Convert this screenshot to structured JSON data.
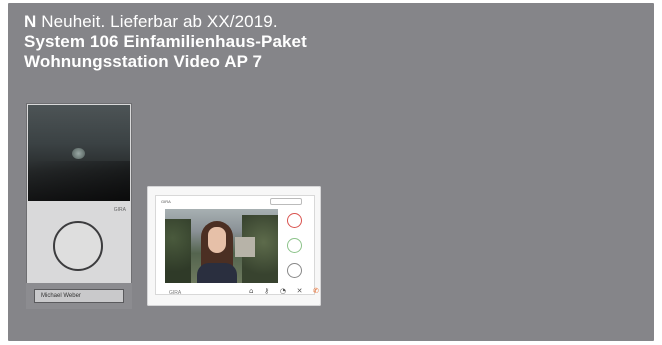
{
  "headline": {
    "line1_prefix": "N",
    "line1_rest": " Neuheit. Lieferbar ab XX/2019.",
    "line2": "System 106 Einfamilienhaus-Paket",
    "line3": "Wohnungsstation Video AP 7"
  },
  "door_station": {
    "brand": "GIRA",
    "name_plate": "Michael Weber"
  },
  "indoor_station": {
    "brand": "GIRA",
    "side_buttons": [
      {
        "icon": "phone-hangup-icon",
        "color": "#d9534f"
      },
      {
        "icon": "phone-accept-icon",
        "color": "#8cc38a"
      },
      {
        "icon": "key-icon",
        "color": "#888888"
      }
    ],
    "footer_icons": [
      {
        "icon": "home-icon"
      },
      {
        "icon": "key-icon"
      },
      {
        "icon": "bell-icon"
      },
      {
        "icon": "mute-icon"
      },
      {
        "icon": "phone-icon",
        "color": "#e96b2b"
      }
    ]
  },
  "colors": {
    "panel_bg": "#858589",
    "text": "#ffffff"
  }
}
